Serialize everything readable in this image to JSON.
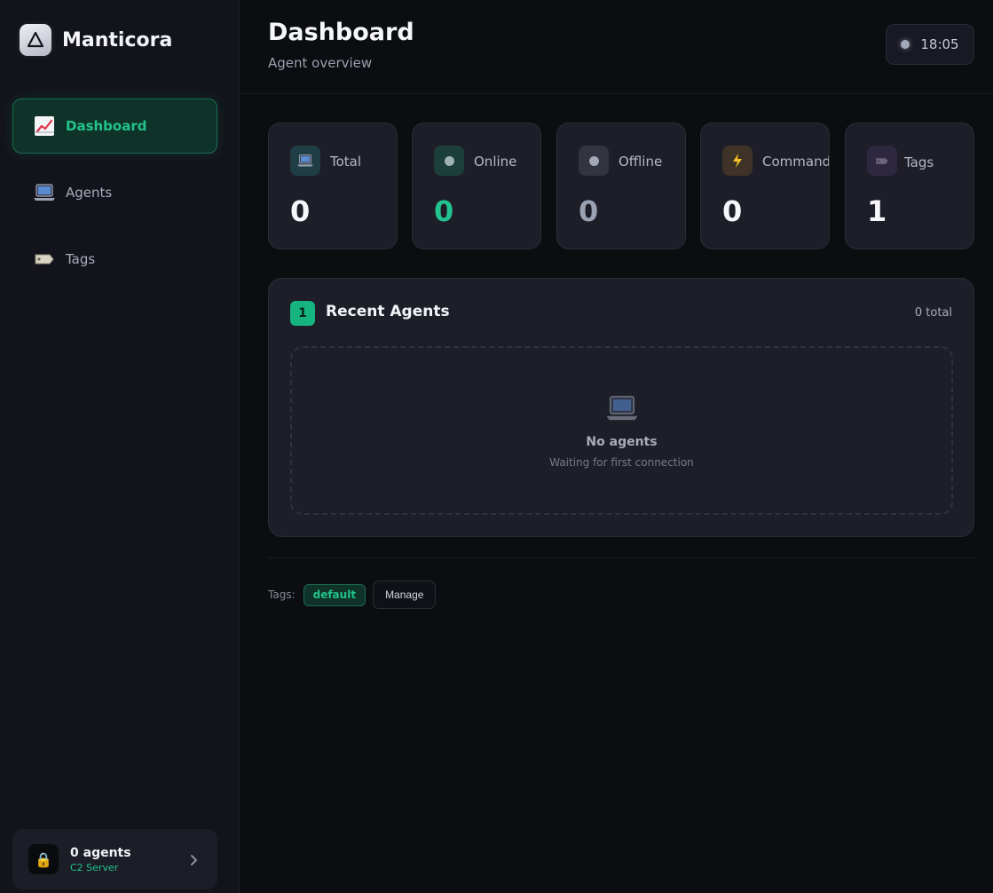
{
  "app": {
    "name": "Manticora"
  },
  "sidebar": {
    "items": [
      {
        "label": "Dashboard",
        "icon": "chart-increasing-icon",
        "active": true
      },
      {
        "label": "Agents",
        "icon": "laptop-icon",
        "active": false
      },
      {
        "label": "Tags",
        "icon": "tag-icon",
        "active": false
      }
    ],
    "server": {
      "title": "0 agents",
      "subtitle": "C2 Server",
      "icon": "lock-icon"
    }
  },
  "header": {
    "title": "Dashboard",
    "subtitle": "Agent overview",
    "clock": "18:05"
  },
  "stats": [
    {
      "label": "Total",
      "value": "0",
      "icon": "laptop-icon"
    },
    {
      "label": "Online",
      "value": "0",
      "icon": "online-dot-icon",
      "value_color": "#22c38e"
    },
    {
      "label": "Offline",
      "value": "0",
      "icon": "offline-dot-icon",
      "value_color": "#9aa1b2"
    },
    {
      "label": "Commands",
      "value": "0",
      "icon": "lightning-icon"
    },
    {
      "label": "Tags",
      "value": "1",
      "icon": "tag-icon"
    }
  ],
  "recent_agents": {
    "badge": "1",
    "title": "Recent Agents",
    "total": "0 total",
    "empty_title": "No agents",
    "empty_subtitle": "Waiting for first connection",
    "empty_icon": "laptop-icon"
  },
  "tags_bar": {
    "label": "Tags:",
    "tags": [
      "default"
    ],
    "manage_label": "Manage"
  },
  "colors": {
    "accent": "#22c38e",
    "background": "#0c0d11",
    "sidebar": "#13141b",
    "card": "#1d1e28"
  }
}
